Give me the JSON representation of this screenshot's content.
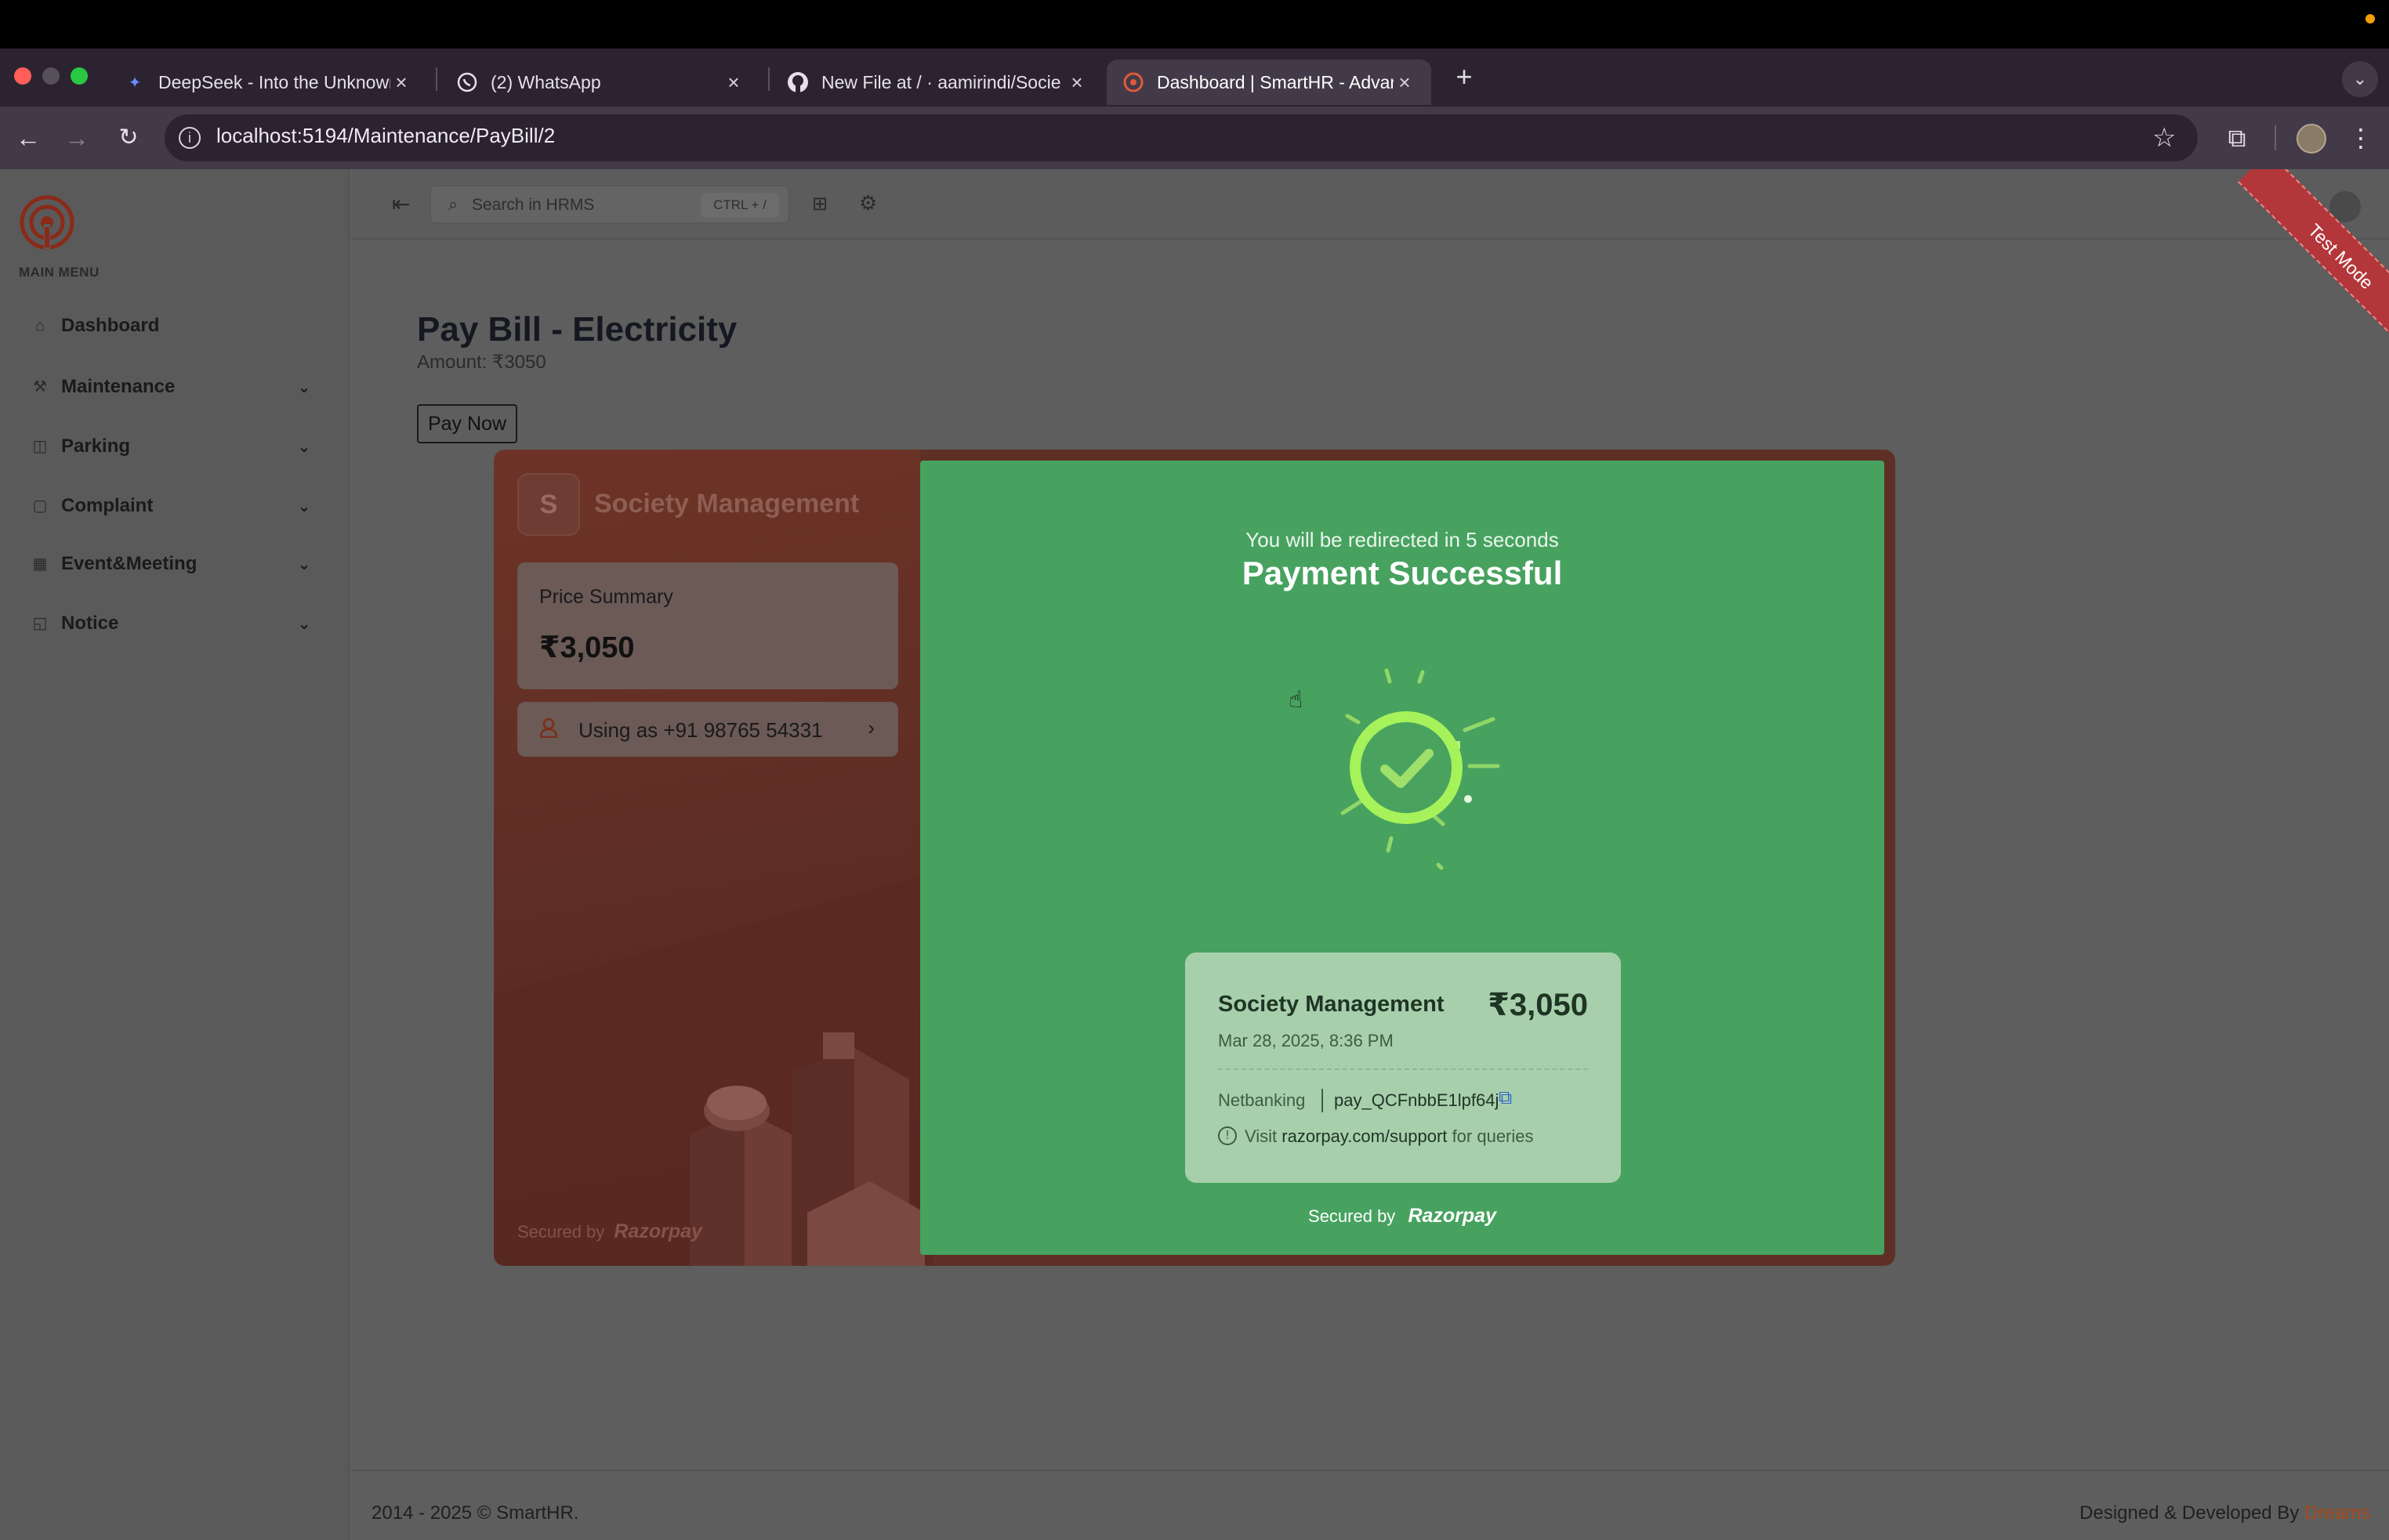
{
  "browser": {
    "tabs": [
      {
        "label": "DeepSeek - Into the Unknown",
        "favicon": "deepseek-icon"
      },
      {
        "label": "(2) WhatsApp",
        "favicon": "whatsapp-icon"
      },
      {
        "label": "New File at / · aamirindi/Socie",
        "favicon": "github-icon"
      },
      {
        "label": "Dashboard | SmartHR - Advan",
        "favicon": "smarthr-icon"
      }
    ],
    "url": "localhost:5194/Maintenance/PayBill/2"
  },
  "sidebar": {
    "section_label": "MAIN MENU",
    "items": [
      {
        "label": "Dashboard",
        "icon": "home-icon"
      },
      {
        "label": "Maintenance",
        "icon": "wrench-icon"
      },
      {
        "label": "Parking",
        "icon": "parking-icon"
      },
      {
        "label": "Complaint",
        "icon": "message-icon"
      },
      {
        "label": "Event&Meeting",
        "icon": "calendar-icon"
      },
      {
        "label": "Notice",
        "icon": "note-icon"
      }
    ]
  },
  "header": {
    "search_placeholder": "Search in HRMS",
    "search_shortcut": "CTRL + /",
    "ribbon": "Test Mode"
  },
  "main": {
    "title": "Pay Bill - Electricity",
    "amount": "Amount: ₹3050",
    "pay_button": "Pay Now"
  },
  "checkout": {
    "merchant_initial": "S",
    "merchant_name": "Society Management",
    "price_summary_label": "Price Summary",
    "price": "₹3,050",
    "contact": "Using as +91 98765 54331",
    "secured_by": "Secured by",
    "brand": "Razorpay",
    "redirect_text": "You will be redirected in 5 seconds",
    "success_title": "Payment Successful",
    "receipt": {
      "merchant": "Society Management",
      "amount": "₹3,050",
      "date": "Mar 28, 2025, 8:36 PM",
      "method": "Netbanking",
      "payment_id": "pay_QCFnbbE1lpf64j",
      "support_prefix": "Visit",
      "support_link": "razorpay.com/support",
      "support_suffix": "for queries"
    }
  },
  "footer": {
    "copyright": "2014 - 2025 © SmartHR.",
    "credit_prefix": "Designed & Developed By",
    "credit_brand": "Dreams"
  },
  "colors": {
    "success_green": "#47a25f",
    "razorpay_brand": "#5e2f25",
    "test_ribbon": "#b3373a",
    "check_ring": "#a6f25a"
  }
}
